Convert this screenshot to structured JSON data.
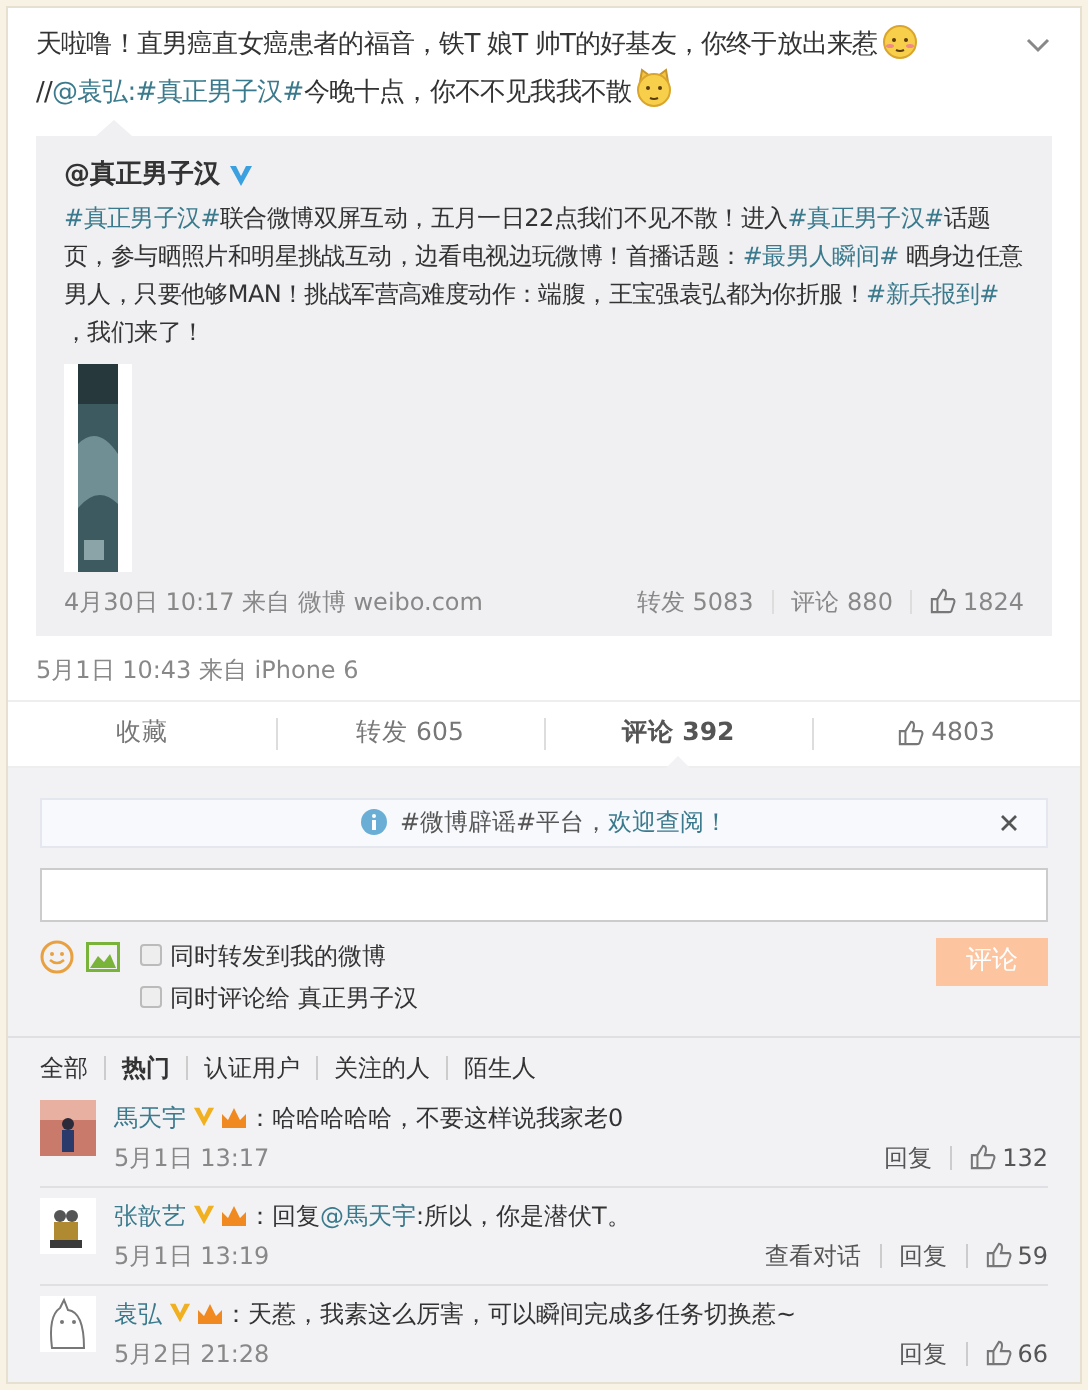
{
  "post": {
    "text": [
      {
        "kind": "text",
        "text": "天啦噜！直男癌直女癌患者的福音，铁T 娘T 帅T的好基友，你终于放出来惹"
      },
      {
        "kind": "emoji"
      },
      {
        "kind": "text",
        "text": "//"
      },
      {
        "kind": "link",
        "text": "@袁弘"
      },
      {
        "kind": "link",
        "text": ":#真正男子汉#"
      },
      {
        "kind": "text",
        "text": "今晚十点，你不不见我我不散"
      },
      {
        "kind": "sticker"
      }
    ],
    "repost": {
      "author": "@真正男子汉",
      "verified": true,
      "text": [
        {
          "kind": "link",
          "text": "#真正男子汉#"
        },
        {
          "kind": "text",
          "text": "联合微博双屏互动，五月一日22点我们不见不散！进入"
        },
        {
          "kind": "link",
          "text": "#真正男子汉#"
        },
        {
          "kind": "text",
          "text": "话题页，参与晒照片和明星挑战互动，边看电视边玩微博！首播话题："
        },
        {
          "kind": "link",
          "text": "#最男人瞬间#"
        },
        {
          "kind": "text",
          "text": " 晒身边任意男人，只要他够MAN！挑战军营高难度动作：端腹，王宝强袁弘都为你折服！"
        },
        {
          "kind": "link",
          "text": "#新兵报到#"
        },
        {
          "kind": "text",
          "text": " ，我们来了！"
        }
      ],
      "time": "4月30日 10:17 来自 微博 weibo.com",
      "forward": "转发 5083",
      "comment": "评论 880",
      "likes": "1824"
    },
    "time": "5月1日 10:43 来自 iPhone 6"
  },
  "actions": [
    {
      "kind": "text",
      "label": "收藏",
      "selected": false
    },
    {
      "kind": "text",
      "label": "转发 605",
      "selected": false
    },
    {
      "kind": "text",
      "label": "评论 392",
      "selected": true
    },
    {
      "kind": "like",
      "label": "4803",
      "selected": false
    }
  ],
  "notice": {
    "text": "#微博辟谣#平台，",
    "link": "欢迎查阅！"
  },
  "composer": {
    "options": [
      {
        "label": "同时转发到我的微博",
        "checked": false
      },
      {
        "label": "同时评论给 真正男子汉",
        "checked": false
      }
    ],
    "submit": "评论",
    "submit_disabled": true
  },
  "filters": [
    {
      "label": "全部",
      "selected": false
    },
    {
      "label": "热门",
      "selected": true
    },
    {
      "label": "认证用户",
      "selected": false
    },
    {
      "label": "关注的人",
      "selected": false
    },
    {
      "label": "陌生人",
      "selected": false
    }
  ],
  "comments": [
    {
      "name": "馬天宇",
      "text": [
        {
          "kind": "text",
          "text": "：哈哈哈哈哈，不要这样说我家老0"
        }
      ],
      "time": "5月1日 13:17",
      "actions": [
        "回复"
      ],
      "likes": "132"
    },
    {
      "name": "张歆艺",
      "text": [
        {
          "kind": "text",
          "text": "：回复"
        },
        {
          "kind": "link",
          "text": "@馬天宇"
        },
        {
          "kind": "text",
          "text": ":所以，你是潜伏T。"
        }
      ],
      "time": "5月1日 13:19",
      "actions": [
        "查看对话",
        "回复"
      ],
      "likes": "59"
    },
    {
      "name": "袁弘",
      "text": [
        {
          "kind": "text",
          "text": "：天惹，我素这么厉害，可以瞬间完成多任务切换惹~"
        }
      ],
      "time": "5月2日 21:28",
      "actions": [
        "回复"
      ],
      "likes": "66"
    }
  ]
}
